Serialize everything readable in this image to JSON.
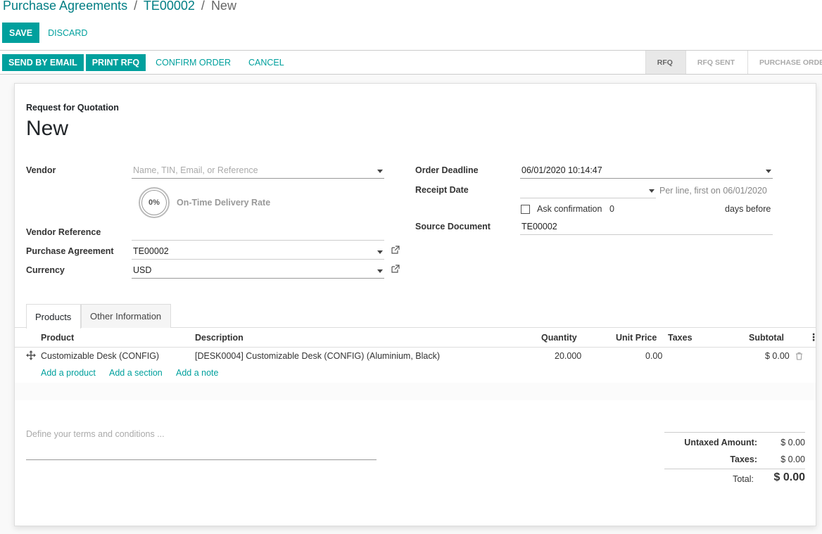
{
  "breadcrumb": {
    "root": "Purchase Agreements",
    "parent": "TE00002",
    "current": "New",
    "separator": "/"
  },
  "toolbar": {
    "save": "SAVE",
    "discard": "DISCARD"
  },
  "statusbar": {
    "actions": [
      "SEND BY EMAIL",
      "PRINT RFQ",
      "CONFIRM ORDER",
      "CANCEL"
    ],
    "stages": [
      "RFQ",
      "RFQ SENT",
      "PURCHASE ORDER"
    ],
    "active_stage": "RFQ"
  },
  "form": {
    "doc_type": "Request for Quotation",
    "title": "New",
    "vendor": {
      "label": "Vendor",
      "placeholder": "Name, TIN, Email, or Reference"
    },
    "ontime": {
      "value": "0%",
      "label": "On-Time Delivery Rate"
    },
    "vendor_reference": {
      "label": "Vendor Reference",
      "value": ""
    },
    "purchase_agreement": {
      "label": "Purchase Agreement",
      "value": "TE00002"
    },
    "currency": {
      "label": "Currency",
      "value": "USD"
    },
    "order_deadline": {
      "label": "Order Deadline",
      "value": "06/01/2020 10:14:47"
    },
    "receipt_date": {
      "label": "Receipt Date",
      "hint": "Per line, first on 06/01/2020"
    },
    "ask_confirmation": {
      "label": "Ask confirmation",
      "value": "0",
      "suffix": "days before"
    },
    "source_document": {
      "label": "Source Document",
      "value": "TE00002"
    }
  },
  "tabs": [
    "Products",
    "Other Information"
  ],
  "table": {
    "headers": {
      "product": "Product",
      "description": "Description",
      "quantity": "Quantity",
      "unit_price": "Unit Price",
      "taxes": "Taxes",
      "subtotal": "Subtotal"
    },
    "rows": [
      {
        "product": "Customizable Desk (CONFIG)",
        "description": "[DESK0004] Customizable Desk (CONFIG) (Aluminium, Black)",
        "quantity": "20.000",
        "unit_price": "0.00",
        "taxes": "",
        "subtotal": "$ 0.00"
      }
    ],
    "add_links": [
      "Add a product",
      "Add a section",
      "Add a note"
    ]
  },
  "terms_placeholder": "Define your terms and conditions ...",
  "totals": {
    "untaxed_label": "Untaxed Amount:",
    "untaxed_value": "$ 0.00",
    "taxes_label": "Taxes:",
    "taxes_value": "$ 0.00",
    "total_label": "Total:",
    "total_value": "$ 0.00"
  },
  "colors": {
    "primary": "#00a09d",
    "link": "#017e84"
  }
}
